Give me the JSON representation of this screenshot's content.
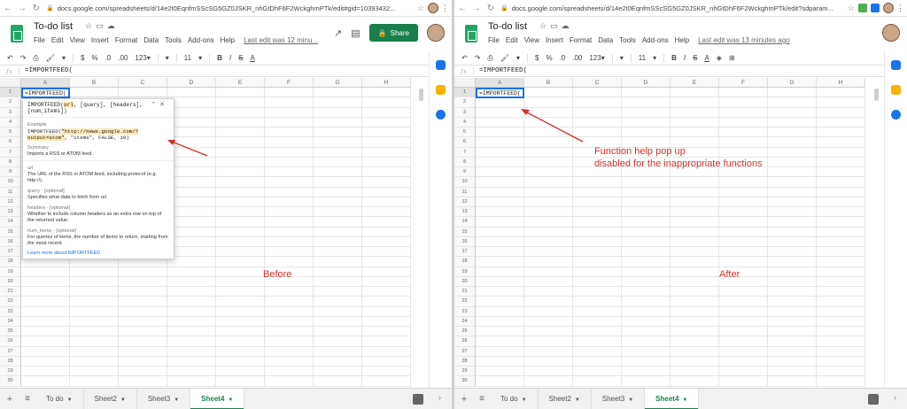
{
  "left": {
    "browser": {
      "url": "docs.google.com/spreadsheets/d/14e2t0EqnfmSScSG5GZ0JSKR_nhGtDhF6F2WckghmPTk/edit#gid=10393432..."
    },
    "doc_title": "To-do list",
    "menus": [
      "File",
      "Edit",
      "View",
      "Insert",
      "Format",
      "Data",
      "Tools",
      "Add-ons",
      "Help"
    ],
    "last_edit": "Last edit was 12 minu...",
    "share_label": "Share",
    "toolbar": [
      "$",
      "%",
      ".0",
      ".00",
      "123▾",
      "▾",
      "11",
      "▾",
      "B",
      "I",
      "S",
      "A"
    ],
    "formula": "=IMPORTFEED(",
    "cell_value": "=IMPORTFEED(",
    "caption": "Before",
    "popup": {
      "signature_pre": "IMPORTFEED(",
      "signature_hl": "url",
      "signature_post": ", [query], [headers], [num_items])",
      "example_title": "Example",
      "example_pre": "IMPORTFEED(",
      "example_hl": "\"http://news.google.com/?output=atom\"",
      "example_post": ", \"items\", FALSE, 10)",
      "summary_title": "Summary",
      "summary_text": "Imports a RSS or ATOM feed.",
      "url_title": "url",
      "url_text": "The URL of the RSS or ATOM feed, including protocol (e.g. http://).",
      "query_title": "query - [optional]",
      "query_text": "Specifies what data to fetch from url.",
      "headers_title": "headers - [optional]",
      "headers_text": "Whether to include column headers as an extra row on top of the returned value.",
      "num_title": "num_items - [optional]",
      "num_text": "For queries of items, the number of items to return, starting from the most recent.",
      "learn_more": "Learn more about IMPORTFEED"
    },
    "tabs": [
      {
        "label": "To do",
        "active": false
      },
      {
        "label": "Sheet2",
        "active": false
      },
      {
        "label": "Sheet3",
        "active": false
      },
      {
        "label": "Sheet4",
        "active": true
      }
    ]
  },
  "right": {
    "browser": {
      "url": "docs.google.com/spreadsheets/d/14e2t0EqnfmSScSG5GZ0JSKR_nhGtDhF6F2WckghmPTk/edit?sdparam..."
    },
    "doc_title": "To-do list",
    "menus": [
      "File",
      "Edit",
      "View",
      "Insert",
      "Format",
      "Data",
      "Tools",
      "Add-ons",
      "Help"
    ],
    "last_edit": "Last edit was 13 minutes ago",
    "toolbar": [
      "$",
      "%",
      ".0",
      ".00",
      "123▾",
      "▾",
      "11",
      "▾",
      "B",
      "I",
      "S",
      "A"
    ],
    "formula": "=IMPORTFEED(",
    "cell_value": "=IMPORTFEED(",
    "caption": "After",
    "annotation_line1": "Function help pop up",
    "annotation_line2": "disabled for the inappropriate functions",
    "tabs": [
      {
        "label": "To do",
        "active": false
      },
      {
        "label": "Sheet2",
        "active": false
      },
      {
        "label": "Sheet3",
        "active": false
      },
      {
        "label": "Sheet4",
        "active": true
      }
    ]
  },
  "grid": {
    "columns": [
      "A",
      "B",
      "C",
      "D",
      "E",
      "F",
      "G",
      "H"
    ],
    "rows": [
      "1",
      "2",
      "3",
      "4",
      "5",
      "6",
      "7",
      "8",
      "9",
      "10",
      "11",
      "12",
      "13",
      "14",
      "15",
      "16",
      "17",
      "18",
      "19",
      "20",
      "21",
      "22",
      "23",
      "24",
      "25",
      "26",
      "27",
      "28",
      "29",
      "30"
    ]
  },
  "colors": {
    "annotation_red": "#d0312d",
    "sheets_green": "#23a566",
    "selection_blue": "#1a73e8"
  }
}
